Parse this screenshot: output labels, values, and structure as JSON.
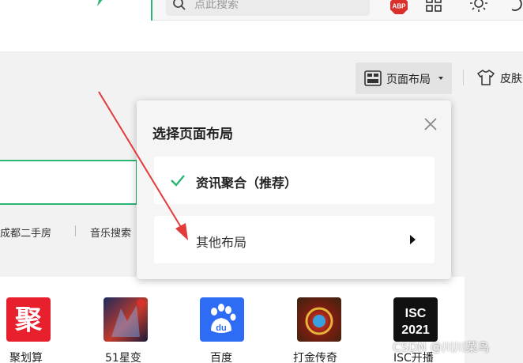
{
  "toolbar": {
    "search_placeholder": "点此搜索",
    "abp_label": "ABP"
  },
  "header": {
    "layout_button_label": "页面布局",
    "skin_button_label": "皮肤"
  },
  "quick_links": [
    "成都二手房",
    "音乐搜索"
  ],
  "tiles": [
    {
      "label": "聚划算",
      "glyph": "聚"
    },
    {
      "label": "51星变",
      "glyph": ""
    },
    {
      "label": "百度",
      "glyph": "du"
    },
    {
      "label": "打金传奇",
      "glyph": ""
    },
    {
      "label": "ISC开播",
      "glyph": "ISC 2021"
    }
  ],
  "popup": {
    "title": "选择页面布局",
    "options": [
      {
        "label": "资讯聚合（推荐）",
        "selected": true
      },
      {
        "label": "其他布局",
        "selected": false
      }
    ]
  },
  "watermark": "CSDN @川川菜鸟",
  "colors": {
    "accent_green": "#2bb673",
    "arrow_red": "#e23b3b",
    "tile_red": "#e8202e",
    "baidu_blue": "#2f6cf6"
  }
}
